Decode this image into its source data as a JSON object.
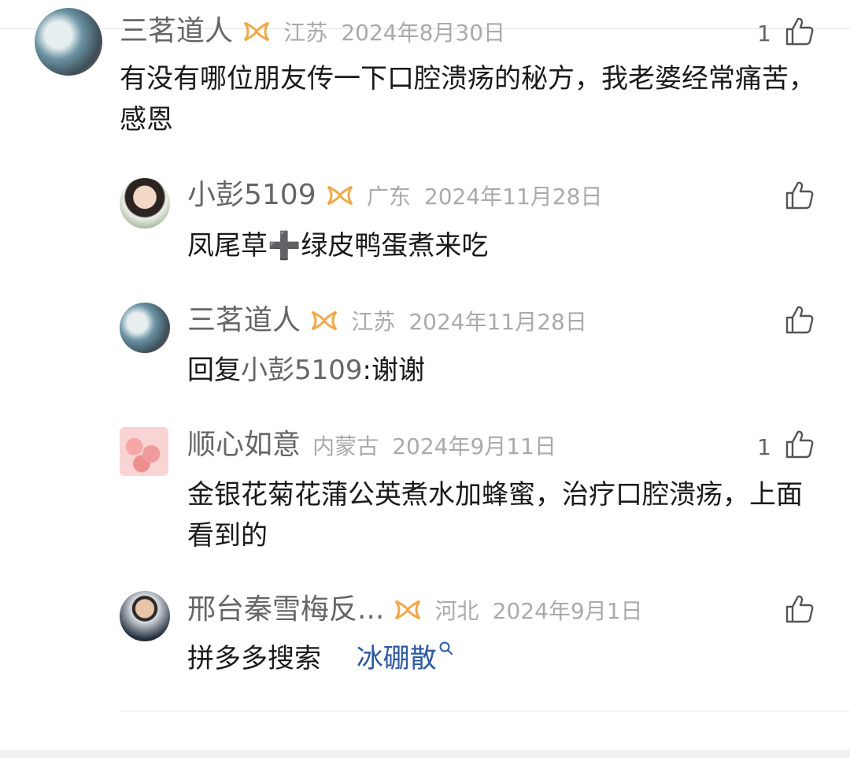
{
  "top_comment": {
    "user": "三茗道人",
    "location": "江苏",
    "date": "2024年8月30日",
    "likes": "1",
    "text": "有没有哪位朋友传一下口腔溃疡的秘方，我老婆经常痛苦，感恩"
  },
  "replies": [
    {
      "user": "小彭5109",
      "location": "广东",
      "date": "2024年11月28日",
      "text": "凤尾草➕绿皮鸭蛋煮来吃"
    },
    {
      "user": "三茗道人",
      "location": "江苏",
      "date": "2024年11月28日",
      "reply_prefix": "回复",
      "reply_to": "小彭5109",
      "reply_text": ":谢谢"
    },
    {
      "user": "顺心如意",
      "location": "内蒙古",
      "date": "2024年9月11日",
      "likes": "1",
      "text": "金银花菊花蒲公英煮水加蜂蜜，治疗口腔溃疡，上面看到的"
    },
    {
      "user": "邢台秦雪梅反...",
      "location": "河北",
      "date": "2024年9月1日",
      "text": "拼多多搜索",
      "link": "冰硼散"
    }
  ],
  "icons": {
    "badge": "vip-badge-icon",
    "like": "thumbs-up-icon",
    "search": "search-icon"
  },
  "colors": {
    "badge": "#f0a94a",
    "link": "#2d5aa0"
  }
}
